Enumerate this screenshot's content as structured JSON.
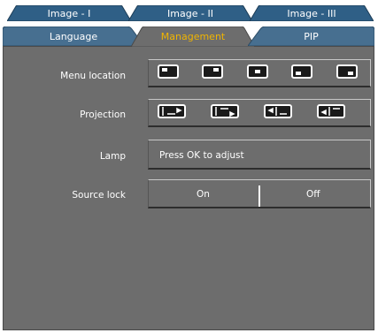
{
  "tabs_top": [
    {
      "label": "Image - I"
    },
    {
      "label": "Image - II"
    },
    {
      "label": "Image - III"
    }
  ],
  "tabs_bottom": [
    {
      "label": "Language"
    },
    {
      "label": "Management",
      "active": true
    },
    {
      "label": "PIP"
    }
  ],
  "colors": {
    "panel": "#6d6d6d",
    "tab_top": "#2f5f86",
    "tab_bottom": "#476f90",
    "active_text": "#f0b400"
  },
  "rows": {
    "menu_location": {
      "label": "Menu   location",
      "options": [
        "menu-top-left-icon",
        "menu-top-right-icon",
        "menu-center-icon",
        "menu-bottom-left-icon",
        "menu-bottom-right-icon"
      ]
    },
    "projection": {
      "label": "Projection",
      "options": [
        "front-desktop-icon",
        "front-ceiling-icon",
        "rear-desktop-icon",
        "rear-ceiling-icon"
      ]
    },
    "lamp": {
      "label": "Lamp",
      "value": "Press OK  to adjust"
    },
    "source_lock": {
      "label": "Source lock",
      "options": [
        "On",
        "Off"
      ]
    }
  }
}
